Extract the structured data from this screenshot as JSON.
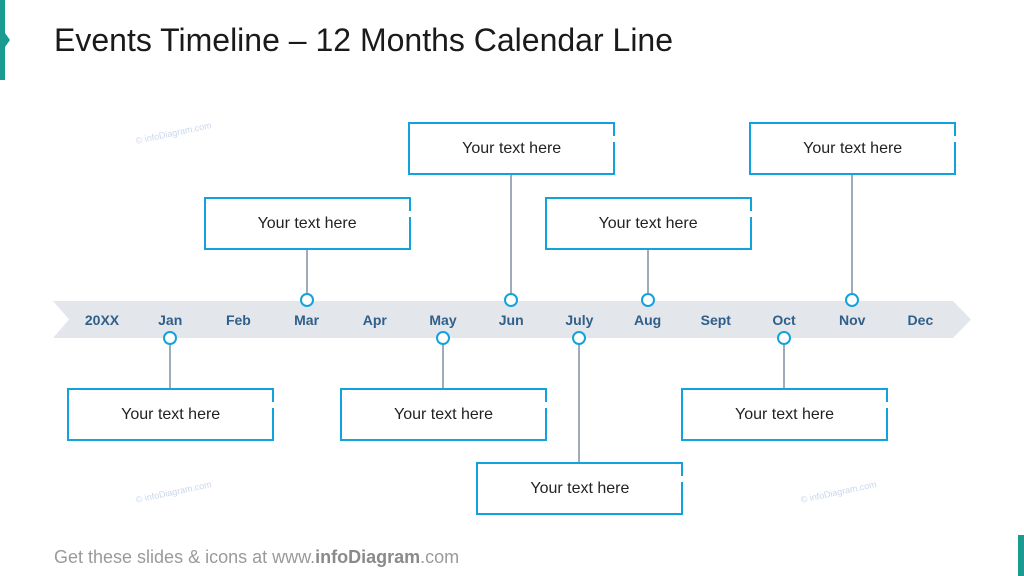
{
  "title": "Events Timeline – 12 Months Calendar Line",
  "watermark": "© infoDiagram.com",
  "colors": {
    "accent": "#1a9b8f",
    "box_border": "#12a3dd",
    "band": "#e3e6eb",
    "month_text": "#2f5f8a"
  },
  "timeline": {
    "months": [
      "20XX",
      "Jan",
      "Feb",
      "Mar",
      "Apr",
      "May",
      "Jun",
      "July",
      "Aug",
      "Sept",
      "Oct",
      "Nov",
      "Dec"
    ]
  },
  "events": [
    {
      "month": "Jan",
      "position": "below",
      "text": "Your text here"
    },
    {
      "month": "Mar",
      "position": "above",
      "text": "Your text here"
    },
    {
      "month": "May",
      "position": "below",
      "text": "Your text here"
    },
    {
      "month": "Jun",
      "position": "above",
      "text": "Your text here"
    },
    {
      "month": "July",
      "position": "below",
      "text": "Your text here"
    },
    {
      "month": "Aug",
      "position": "above",
      "text": "Your text here"
    },
    {
      "month": "Oct",
      "position": "below",
      "text": "Your text here"
    },
    {
      "month": "Nov",
      "position": "above",
      "text": "Your text here"
    }
  ],
  "footer": {
    "prefix": "Get these slides & icons at www.",
    "brand": "infoDiagram",
    "suffix": ".com"
  }
}
